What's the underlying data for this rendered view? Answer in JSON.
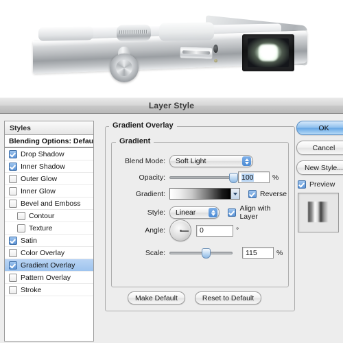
{
  "window": {
    "title": "Layer Style"
  },
  "artwork": {
    "name": "camera-render"
  },
  "styles_panel": {
    "header": "Styles",
    "items": [
      {
        "label": "Blending Options: Default",
        "checkbox": false,
        "bold": true,
        "indent": false,
        "selected": false
      },
      {
        "label": "Drop Shadow",
        "checkbox": true,
        "checked": true,
        "indent": false,
        "selected": false
      },
      {
        "label": "Inner Shadow",
        "checkbox": true,
        "checked": true,
        "indent": false,
        "selected": false
      },
      {
        "label": "Outer Glow",
        "checkbox": true,
        "checked": false,
        "indent": false,
        "selected": false
      },
      {
        "label": "Inner Glow",
        "checkbox": true,
        "checked": false,
        "indent": false,
        "selected": false
      },
      {
        "label": "Bevel and Emboss",
        "checkbox": true,
        "checked": false,
        "indent": false,
        "selected": false
      },
      {
        "label": "Contour",
        "checkbox": true,
        "checked": false,
        "indent": true,
        "selected": false
      },
      {
        "label": "Texture",
        "checkbox": true,
        "checked": false,
        "indent": true,
        "selected": false
      },
      {
        "label": "Satin",
        "checkbox": true,
        "checked": true,
        "indent": false,
        "selected": false
      },
      {
        "label": "Color Overlay",
        "checkbox": true,
        "checked": false,
        "indent": false,
        "selected": false
      },
      {
        "label": "Gradient Overlay",
        "checkbox": true,
        "checked": true,
        "indent": false,
        "selected": true
      },
      {
        "label": "Pattern Overlay",
        "checkbox": true,
        "checked": false,
        "indent": false,
        "selected": false
      },
      {
        "label": "Stroke",
        "checkbox": true,
        "checked": false,
        "indent": false,
        "selected": false
      }
    ]
  },
  "panel": {
    "section_title": "Gradient Overlay",
    "group_title": "Gradient",
    "blend_mode": {
      "label": "Blend Mode:",
      "value": "Soft Light"
    },
    "opacity": {
      "label": "Opacity:",
      "value": "100",
      "unit": "%",
      "slider_percent": 100
    },
    "gradient": {
      "label": "Gradient:",
      "from_color": "#ffffff",
      "to_color": "#000000"
    },
    "reverse": {
      "label": "Reverse",
      "checked": true
    },
    "style": {
      "label": "Style:",
      "value": "Linear"
    },
    "align_with_layer": {
      "label": "Align with Layer",
      "checked": true
    },
    "angle": {
      "label": "Angle:",
      "value": "0",
      "unit": "°",
      "degrees": 0
    },
    "scale": {
      "label": "Scale:",
      "value": "115",
      "unit": "%",
      "slider_percent": 57
    },
    "make_default": "Make Default",
    "reset_to_default": "Reset to Default"
  },
  "actions": {
    "ok": "OK",
    "cancel": "Cancel",
    "new_style": "New Style...",
    "preview": {
      "label": "Preview",
      "checked": true
    }
  },
  "colors": {
    "accent": "#6aa6e4",
    "selection": "#9ec4ee",
    "dialog_bg": "#ededed"
  }
}
